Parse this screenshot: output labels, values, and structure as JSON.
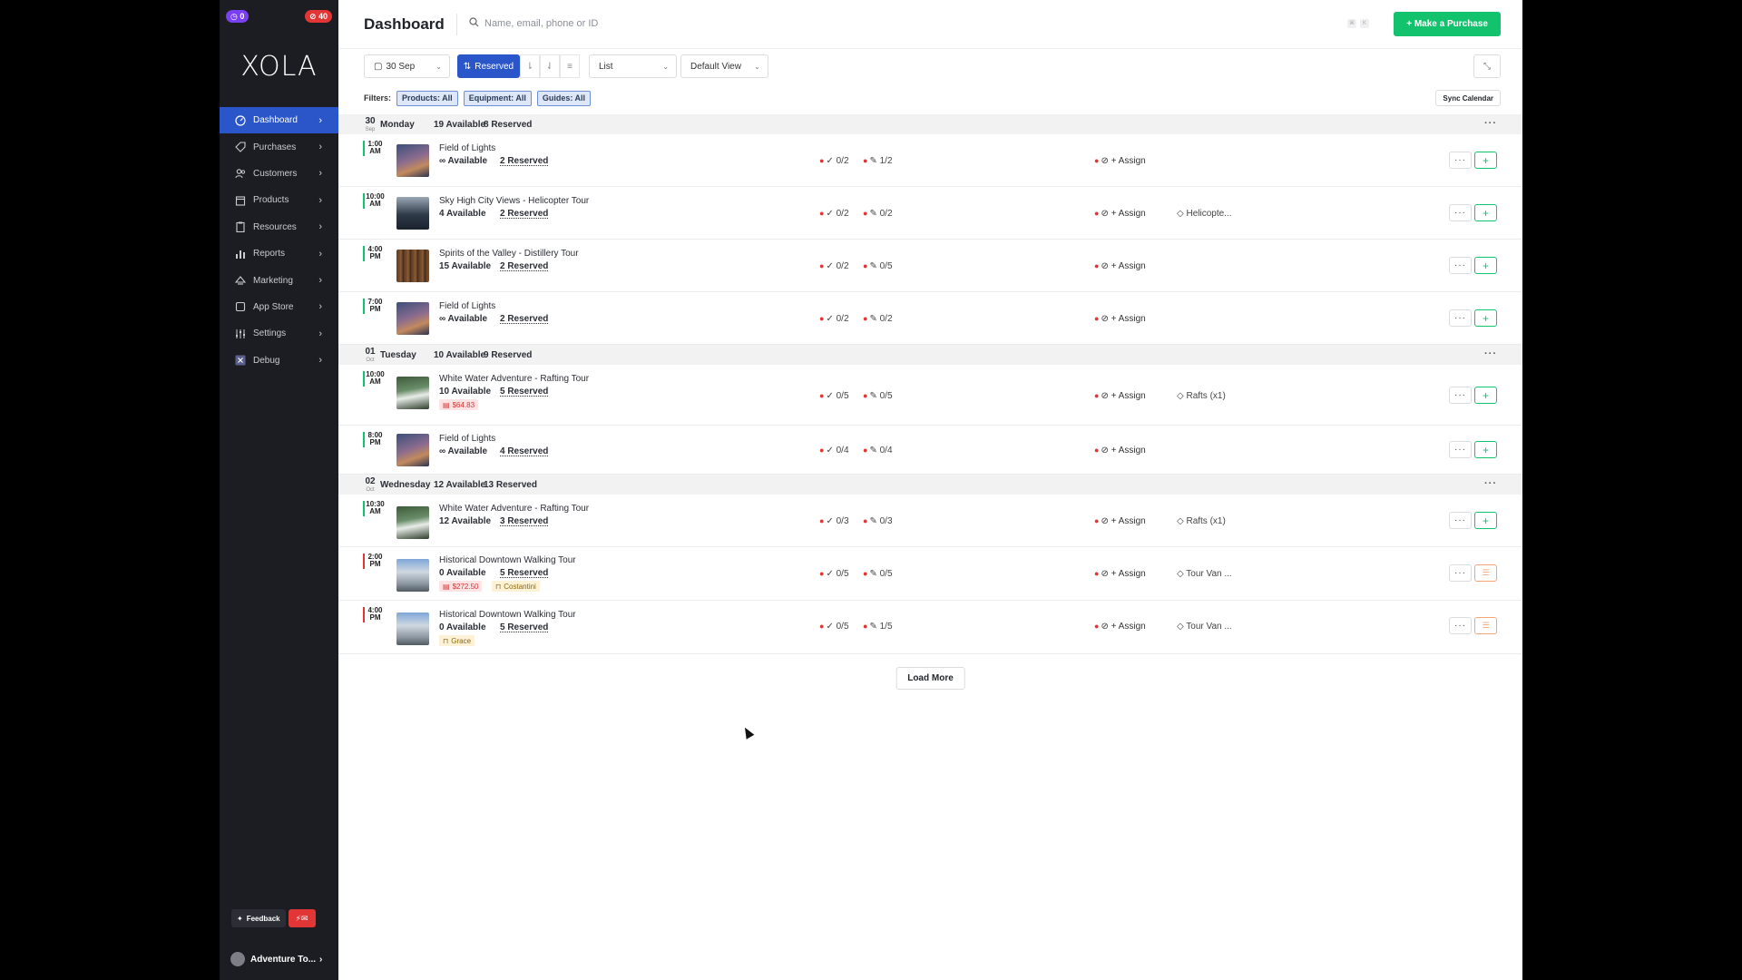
{
  "sidebar": {
    "badges": {
      "left": "0",
      "right": "40"
    },
    "logo": "XOLA",
    "items": [
      {
        "label": "Dashboard",
        "icon": "dashboard-icon",
        "active": true
      },
      {
        "label": "Purchases",
        "icon": "tag-icon"
      },
      {
        "label": "Customers",
        "icon": "users-icon"
      },
      {
        "label": "Products",
        "icon": "box-icon"
      },
      {
        "label": "Resources",
        "icon": "clipboard-icon"
      },
      {
        "label": "Reports",
        "icon": "bar-chart-icon"
      },
      {
        "label": "Marketing",
        "icon": "megaphone-icon"
      },
      {
        "label": "App Store",
        "icon": "store-icon"
      },
      {
        "label": "Settings",
        "icon": "sliders-icon"
      },
      {
        "label": "Debug",
        "icon": "x-icon"
      }
    ],
    "feedback_label": "Feedback",
    "account_name": "Adventure To..."
  },
  "header": {
    "title": "Dashboard",
    "search_placeholder": "Name, email, phone or ID",
    "purchase_button": "+ Make a Purchase"
  },
  "toolbar": {
    "date": "30 Sep",
    "reserved": "Reserved",
    "view_type": "List",
    "view_name": "Default View"
  },
  "filters": {
    "label": "Filters:",
    "products": "Products: All",
    "equipment": "Equipment: All",
    "guides": "Guides: All",
    "sync": "Sync Calendar"
  },
  "days": [
    {
      "num": "30",
      "month": "Sep",
      "name": "Monday",
      "available": "19 Available",
      "reserved": "8 Reserved",
      "events": [
        {
          "time": "1:00 AM",
          "title": "Field of Lights",
          "avail": "∞ Available",
          "reserved": "2 Reserved",
          "check": "0/2",
          "guides": "1/2",
          "assign": "+ Assign",
          "equip": ""
        },
        {
          "time": "10:00 AM",
          "title": "Sky High City Views - Helicopter Tour",
          "avail": "4 Available",
          "reserved": "2 Reserved",
          "check": "0/2",
          "guides": "0/2",
          "assign": "+ Assign",
          "equip": "Helicopte..."
        },
        {
          "time": "4:00 PM",
          "title": "Spirits of the Valley - Distillery Tour",
          "avail": "15 Available",
          "reserved": "2 Reserved",
          "check": "0/2",
          "guides": "0/5",
          "assign": "+ Assign",
          "equip": ""
        },
        {
          "time": "7:00 PM",
          "title": "Field of Lights",
          "avail": "∞ Available",
          "reserved": "2 Reserved",
          "check": "0/2",
          "guides": "0/2",
          "assign": "+ Assign",
          "equip": ""
        }
      ]
    },
    {
      "num": "01",
      "month": "Oct",
      "name": "Tuesday",
      "available": "10 Available",
      "reserved": "9 Reserved",
      "events": [
        {
          "time": "10:00 AM",
          "title": "White Water Adventure - Rafting Tour",
          "avail": "10 Available",
          "reserved": "5 Reserved",
          "price": "$64.83",
          "check": "0/5",
          "guides": "0/5",
          "assign": "+ Assign",
          "equip": "Rafts (x1)"
        },
        {
          "time": "8:00 PM",
          "title": "Field of Lights",
          "avail": "∞ Available",
          "reserved": "4 Reserved",
          "check": "0/4",
          "guides": "0/4",
          "assign": "+ Assign",
          "equip": ""
        }
      ]
    },
    {
      "num": "02",
      "month": "Oct",
      "name": "Wednesday",
      "available": "12 Available",
      "reserved": "13 Reserved",
      "events": [
        {
          "time": "10:30 AM",
          "title": "White Water Adventure - Rafting Tour",
          "avail": "12 Available",
          "reserved": "3 Reserved",
          "check": "0/3",
          "guides": "0/3",
          "assign": "+ Assign",
          "equip": "Rafts (x1)"
        },
        {
          "time": "2:00 PM",
          "title": "Historical Downtown Walking Tour",
          "avail": "0 Available",
          "reserved": "5 Reserved",
          "price": "$272.50",
          "guide": "Costantini",
          "check": "0/5",
          "guides": "0/5",
          "assign": "+ Assign",
          "equip": "Tour Van ..."
        },
        {
          "time": "4:00 PM",
          "title": "Historical Downtown Walking Tour",
          "avail": "0 Available",
          "reserved": "5 Reserved",
          "guide": "Grace",
          "check": "0/5",
          "guides": "1/5",
          "assign": "+ Assign",
          "equip": "Tour Van ..."
        }
      ]
    }
  ],
  "load_more": "Load More"
}
